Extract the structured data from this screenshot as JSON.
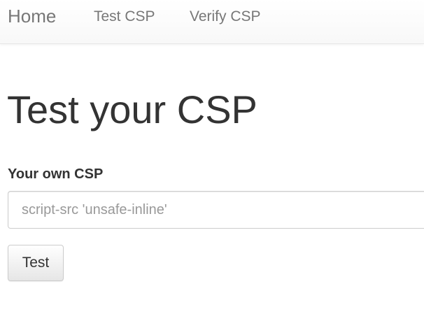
{
  "navbar": {
    "brand": "Home",
    "links": [
      {
        "label": "Test CSP"
      },
      {
        "label": "Verify CSP"
      }
    ]
  },
  "main": {
    "title": "Test your CSP",
    "form": {
      "label": "Your own CSP",
      "input_value": "",
      "input_placeholder": "script-src 'unsafe-inline'",
      "submit_label": "Test"
    }
  },
  "colors": {
    "nav_text": "#777777",
    "body_text": "#333333",
    "placeholder": "#999999"
  }
}
